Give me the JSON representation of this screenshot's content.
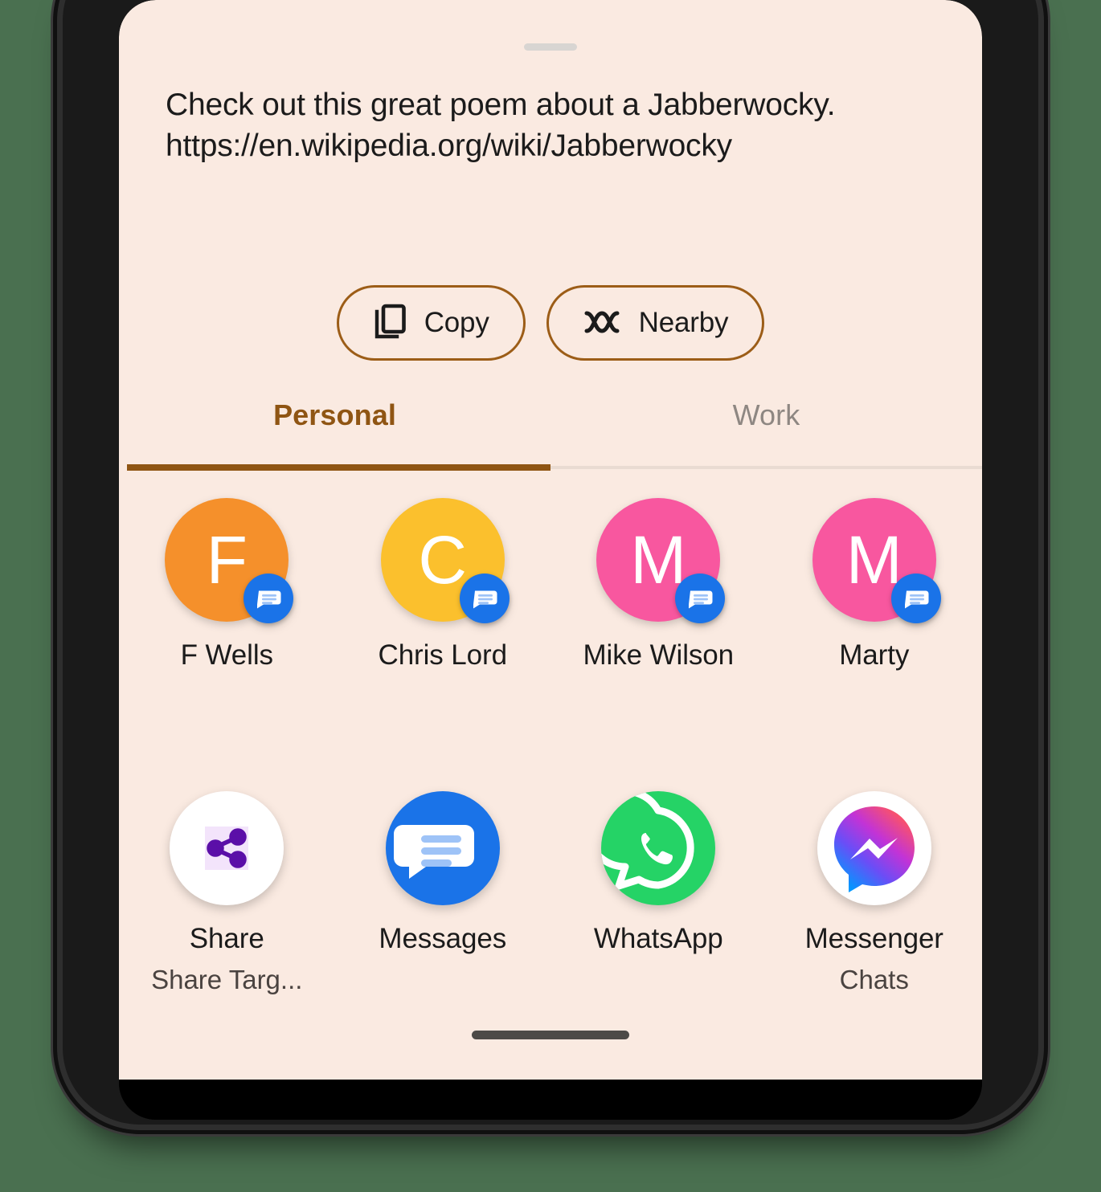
{
  "share_sheet": {
    "drag_handle": "drag-handle",
    "preview": {
      "line1": "Check out this great poem about a Jabberwocky.",
      "line2": "https://en.wikipedia.org/wiki/Jabberwocky"
    },
    "actions": [
      {
        "label": "Copy",
        "icon": "copy-icon"
      },
      {
        "label": "Nearby",
        "icon": "nearby-share-icon"
      }
    ],
    "tabs": [
      {
        "label": "Personal",
        "active": true
      },
      {
        "label": "Work",
        "active": false
      }
    ],
    "contacts": [
      {
        "name": "F Wells",
        "initial": "F",
        "color": "#f5902b",
        "badge": "messages-icon"
      },
      {
        "name": "Chris Lord",
        "initial": "C",
        "color": "#fbc02d",
        "badge": "messages-icon"
      },
      {
        "name": "Mike Wilson",
        "initial": "M",
        "color": "#f8579f",
        "badge": "messages-icon"
      },
      {
        "name": "Marty",
        "initial": "M",
        "color": "#f8579f",
        "badge": "messages-icon"
      }
    ],
    "apps": [
      {
        "name": "Share",
        "subtitle": "Share Targ...",
        "icon": "share-target-icon"
      },
      {
        "name": "Messages",
        "subtitle": "",
        "icon": "messages-app-icon"
      },
      {
        "name": "WhatsApp",
        "subtitle": "",
        "icon": "whatsapp-icon"
      },
      {
        "name": "Messenger",
        "subtitle": "Chats",
        "icon": "messenger-icon"
      }
    ]
  },
  "colors": {
    "sheet_background": "#faeae1",
    "accent_brown": "#8f5513",
    "outer_background": "#4a7050",
    "messages_blue": "#1a73e8",
    "whatsapp_green": "#25d366"
  }
}
